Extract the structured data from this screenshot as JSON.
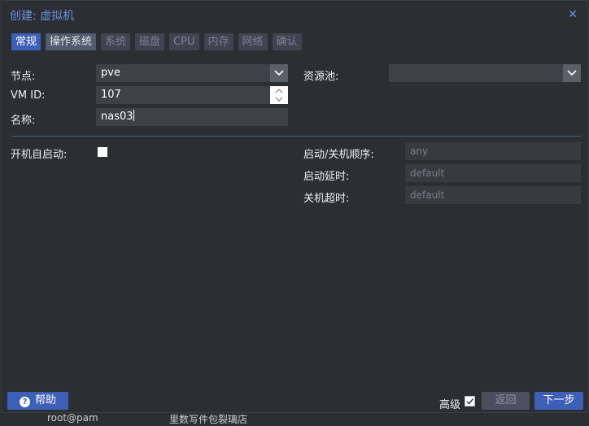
{
  "background": {
    "text_1": "root@pam",
    "text_2": "里数写件包裂璃店"
  },
  "dialog": {
    "title": "创建: 虚拟机",
    "close_icon": "close-icon",
    "tabs": [
      {
        "label": "常规",
        "state": "active"
      },
      {
        "label": "操作系统",
        "state": "enabled"
      },
      {
        "label": "系统",
        "state": "disabled"
      },
      {
        "label": "磁盘",
        "state": "disabled"
      },
      {
        "label": "CPU",
        "state": "disabled"
      },
      {
        "label": "内存",
        "state": "disabled"
      },
      {
        "label": "网络",
        "state": "disabled"
      },
      {
        "label": "确认",
        "state": "disabled"
      }
    ],
    "form": {
      "node_label": "节点:",
      "node_value": "pve",
      "vmid_label": "VM ID:",
      "vmid_value": "107",
      "name_label": "名称:",
      "name_value": "nas03",
      "pool_label": "资源池:",
      "pool_value": "",
      "autostart_label": "开机自启动:",
      "autostart_checked": false,
      "order_label": "启动/关机顺序:",
      "order_placeholder": "any",
      "startup_delay_label": "启动延时:",
      "startup_delay_placeholder": "default",
      "shutdown_timeout_label": "关机超时:",
      "shutdown_timeout_placeholder": "default"
    },
    "footer": {
      "help_label": "帮助",
      "advanced_label": "高级",
      "advanced_checked": true,
      "back_label": "返回",
      "next_label": "下一步"
    }
  },
  "colors": {
    "accent": "#3e5fb8",
    "title": "#6f8fe0",
    "background": "#2b2e33"
  }
}
